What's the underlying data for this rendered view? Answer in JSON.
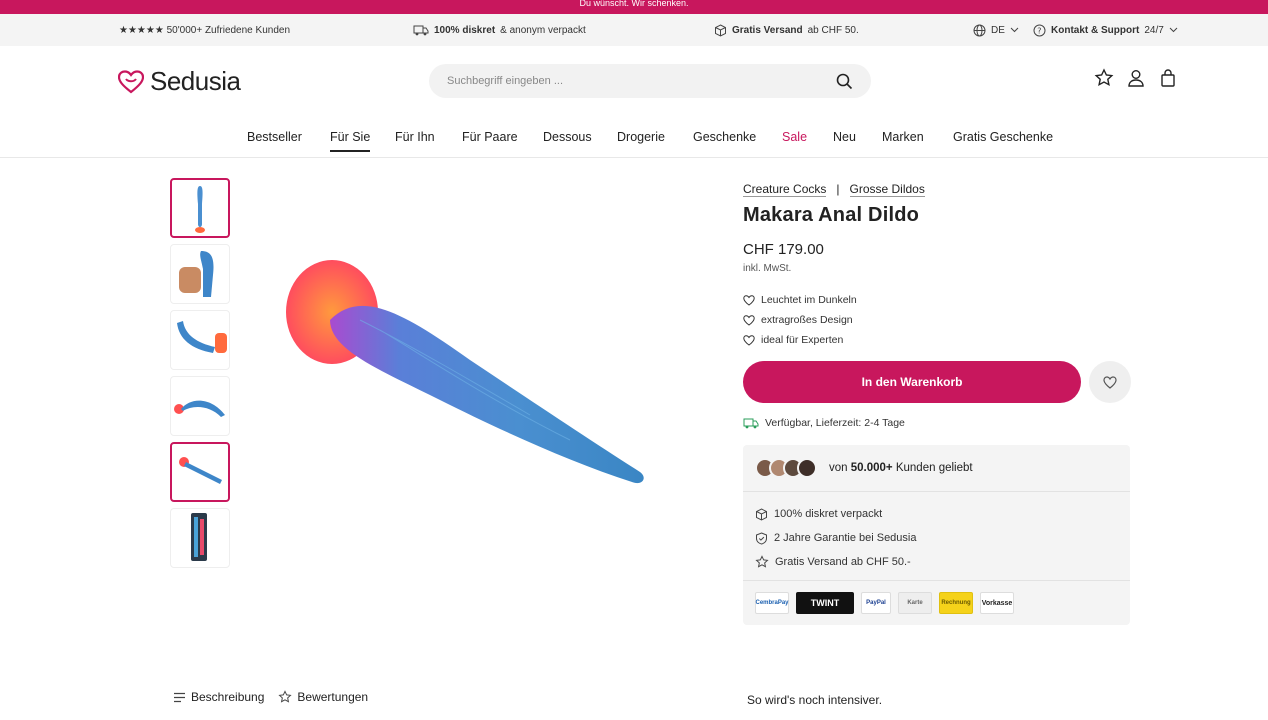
{
  "promo": {
    "text": "Du wünscht. Wir schenken."
  },
  "usp_bar": {
    "rating": "★★★★★ 50'000+ Zufriedene Kunden",
    "discreet_bold": "100% diskret",
    "discreet_rest": "& anonym verpackt",
    "shipping_bold": "Gratis Versand",
    "shipping_rest": "ab CHF 50.",
    "language": "DE",
    "support_bold": "Kontakt & Support",
    "support_rest": "24/7"
  },
  "header": {
    "logo": "Sedusia",
    "search_placeholder": "Suchbegriff eingeben ..."
  },
  "nav": {
    "items": [
      "Bestseller",
      "Für Sie",
      "Für Ihn",
      "Für Paare",
      "Dessous",
      "Drogerie",
      "Geschenke",
      "Sale",
      "Neu",
      "Marken",
      "Gratis Geschenke"
    ],
    "active": "Für Sie",
    "highlight": "Sale"
  },
  "product": {
    "brand": "Creature Cocks",
    "separator": "|",
    "category": "Grosse Dildos",
    "title": "Makara Anal Dildo",
    "price": "CHF 179.00",
    "vat": "inkl. MwSt.",
    "features": [
      "Leuchtet im Dunkeln",
      "extragroßes Design",
      "ideal für Experten"
    ],
    "cart_button": "In den Warenkorb",
    "availability": "Verfügbar, Lieferzeit: 2-4 Tage"
  },
  "trust": {
    "prefix": "von",
    "count": "50.000+",
    "suffix": "Kunden geliebt",
    "items": [
      "100% diskret verpackt",
      "2 Jahre Garantie bei Sedusia",
      "Gratis Versand ab CHF 50.-"
    ]
  },
  "payments": [
    "CembraPay",
    "TWINT",
    "PayPal",
    "Karte",
    "Rechnung",
    "Vorkasse"
  ],
  "tabs": {
    "description": "Beschreibung",
    "reviews": "Bewertungen"
  },
  "upsell_title": "So wird's noch intensiver.",
  "colors": {
    "brand": "#c8175d",
    "product_blue": "#4a8fd0",
    "product_orange": "#ff6a3d"
  },
  "gallery": {
    "thumbnail_count": 6
  }
}
